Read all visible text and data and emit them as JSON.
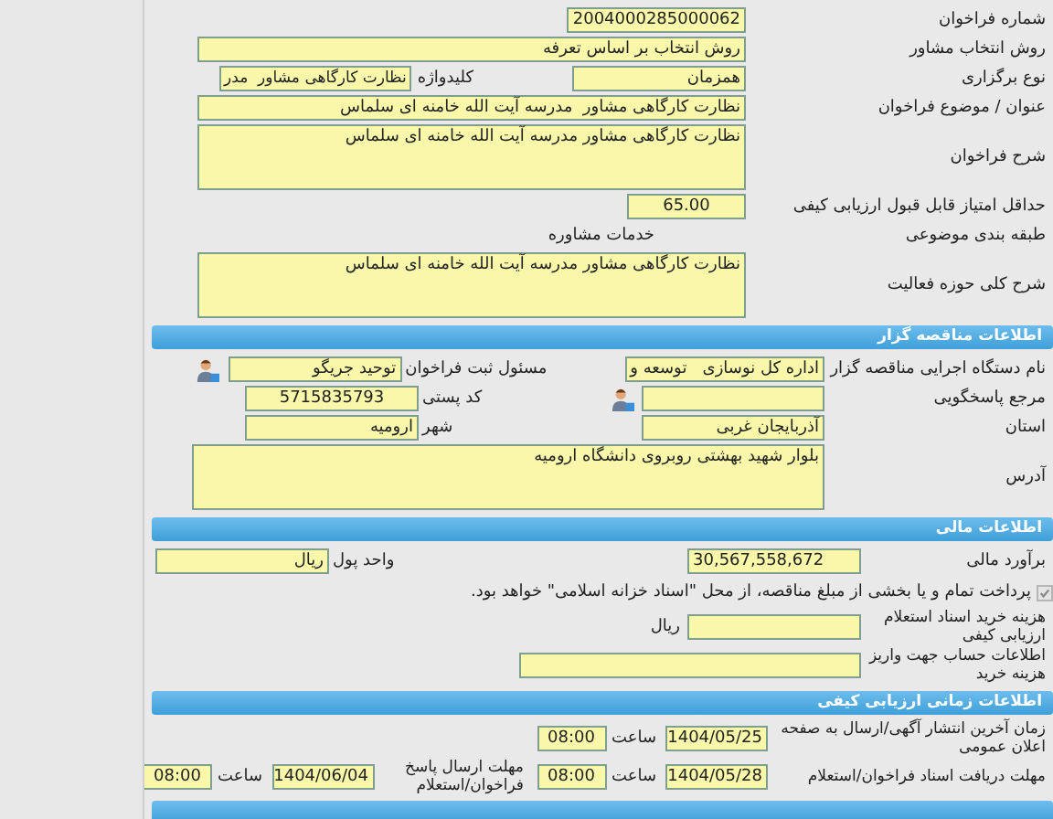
{
  "general": {
    "tender_number": {
      "label": "شماره فراخوان",
      "value": "2004000285000062"
    },
    "selection_method": {
      "label": "روش انتخاب مشاور",
      "value": "روش انتخاب بر اساس تعرفه"
    },
    "holding_type": {
      "label": "نوع برگزاری",
      "value": "همزمان"
    },
    "keyword": {
      "label": "کلیدواژه",
      "value": "نظارت کارگاهی مشاور  مدر"
    },
    "subject": {
      "label": "عنوان / موضوع فراخوان",
      "value": "نظارت کارگاهی مشاور  مدرسه آیت الله خامنه ای سلماس"
    },
    "description": {
      "label": "شرح فراخوان",
      "value": "نظارت کارگاهی مشاور  مدرسه آیت الله خامنه ای سلماس"
    },
    "min_quality_score": {
      "label": "حداقل امتیاز قابل قبول ارزیابی کیفی",
      "value": "65.00"
    },
    "category": {
      "label": "طبقه بندی موضوعی",
      "value": "خدمات مشاوره"
    },
    "activity_scope": {
      "label": "شرح کلی حوزه فعالیت",
      "value": "نظارت کارگاهی مشاور  مدرسه آیت الله خامنه ای سلماس"
    }
  },
  "tenderer": {
    "header": "اطلاعات مناقصه گزار",
    "organization": {
      "label": "نام دستگاه اجرایی مناقصه گزار",
      "value": "اداره کل نوسازی   توسعه و"
    },
    "registrar": {
      "label": "مسئول ثبت فراخوان",
      "value": "توحید جریگو"
    },
    "contact_reference": {
      "label": "مرجع پاسخگویی"
    },
    "postal_code": {
      "label": "کد پستی",
      "value": "5715835793"
    },
    "province": {
      "label": "استان",
      "value": "آذربایجان غربی"
    },
    "city": {
      "label": "شهر",
      "value": "ارومیه"
    },
    "address": {
      "label": "آدرس",
      "value": "بلوار شهید بهشتی روبروی دانشگاه ارومیه"
    }
  },
  "financial": {
    "header": "اطلاعات مالی",
    "estimate": {
      "label": "برآورد مالی",
      "value": "30,567,558,672"
    },
    "currency": {
      "label": "واحد پول",
      "value": "ریال"
    },
    "treasury_payment": {
      "label": "پرداخت تمام و یا بخشی از مبلغ مناقصه، از محل \"اسناد خزانه اسلامی\" خواهد بود.",
      "checked": true
    },
    "document_fee": {
      "label": "هزینه خرید اسناد استعلام ارزیابی کیفی",
      "unit": "ریال"
    },
    "account_info": {
      "label": "اطلاعات حساب جهت واریز هزینه خرید"
    }
  },
  "timing": {
    "header": "اطلاعات زمانی ارزیابی کیفی",
    "rows": [
      {
        "entries": [
          {
            "label": "زمان آخرین انتشار آگهی/ارسال به صفحه اعلان عمومی",
            "date": "1404/05/25",
            "time_label": "ساعت",
            "time": "08:00"
          }
        ]
      },
      {
        "entries": [
          {
            "label": "مهلت دریافت اسناد فراخوان/استعلام",
            "date": "1404/05/28",
            "time_label": "ساعت",
            "time": "08:00"
          },
          {
            "label": "مهلت ارسال پاسخ فراخوان/استعلام",
            "date": "1404/06/04",
            "time_label": "ساعت",
            "time": "08:00"
          }
        ]
      }
    ]
  }
}
